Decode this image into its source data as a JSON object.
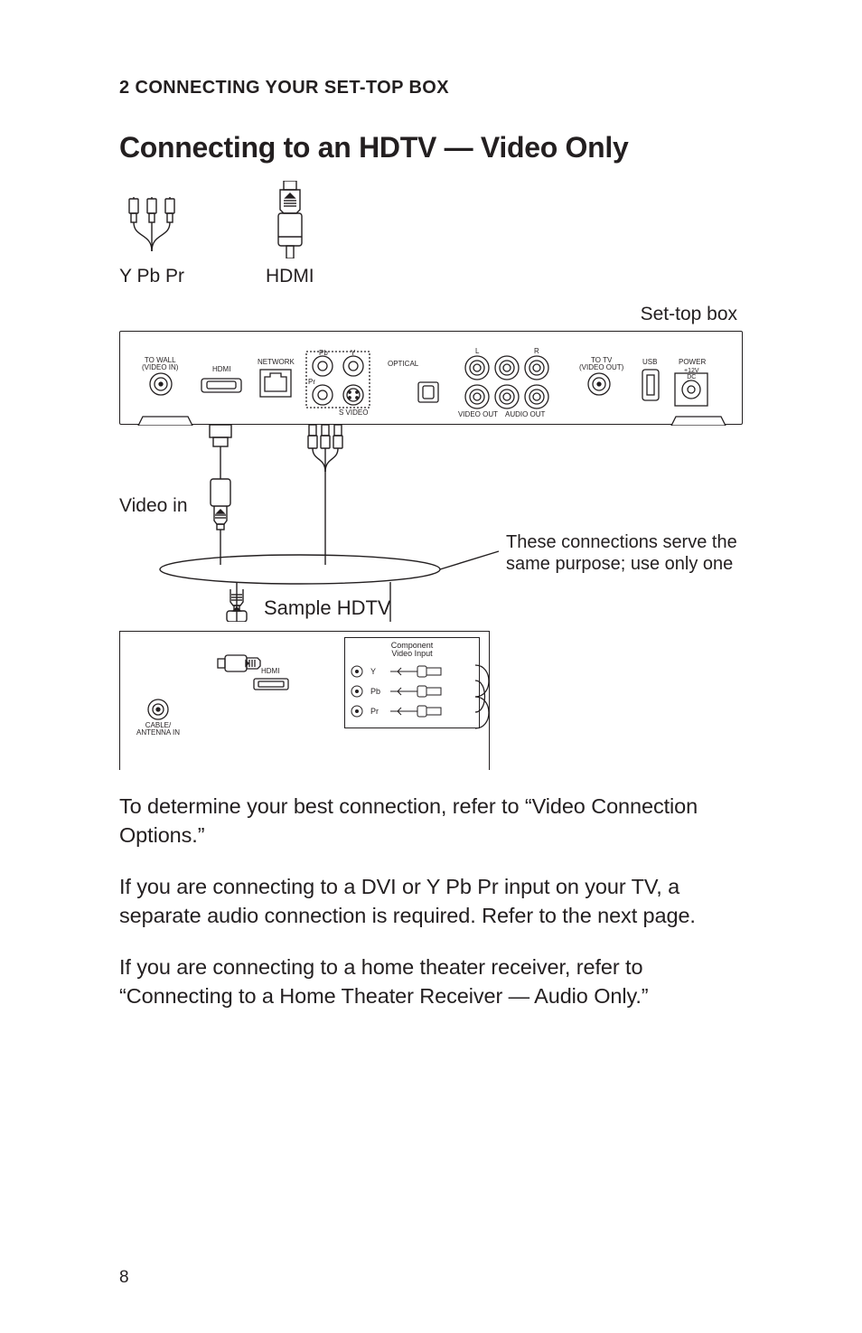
{
  "section_label": "2 CONNECTING YOUR SET-TOP BOX",
  "title": "Connecting to an HDTV — Video Only",
  "cables": {
    "ypbpr": "Y Pb Pr",
    "hdmi": "HDMI"
  },
  "stb": {
    "caption": "Set-top box",
    "ports": {
      "to_wall": "TO WALL\n(VIDEO IN)",
      "hdmi": "HDMI",
      "network": "NETWORK",
      "pb": "Pb",
      "y": "Y",
      "pr": "Pr",
      "svideo": "S VIDEO",
      "optical": "OPTICAL",
      "l": "L",
      "r": "R",
      "video_out": "VIDEO OUT",
      "audio_out": "AUDIO OUT",
      "to_tv": "TO TV\n(VIDEO OUT)",
      "usb": "USB",
      "power": "POWER",
      "dc": "+12V\nDC"
    }
  },
  "video_in": "Video in",
  "note": "These connections serve the same purpose; use only one",
  "hdtv": {
    "title": "Sample HDTV",
    "cable_antenna": "CABLE/\nANTENNA IN",
    "hdmi": "HDMI",
    "comp_title": "Component\nVideo Input",
    "y": "Y",
    "pb": "Pb",
    "pr": "Pr"
  },
  "paragraphs": [
    "To determine your best connection, refer to “Video Connection Options.”",
    "If you are connecting to a DVI or Y Pb Pr input on your TV, a separate audio connection is required. Refer to the next page.",
    "If you are connecting to a home theater receiver, refer to “Connecting to a Home Theater Receiver — Audio Only.”"
  ],
  "page_number": "8"
}
